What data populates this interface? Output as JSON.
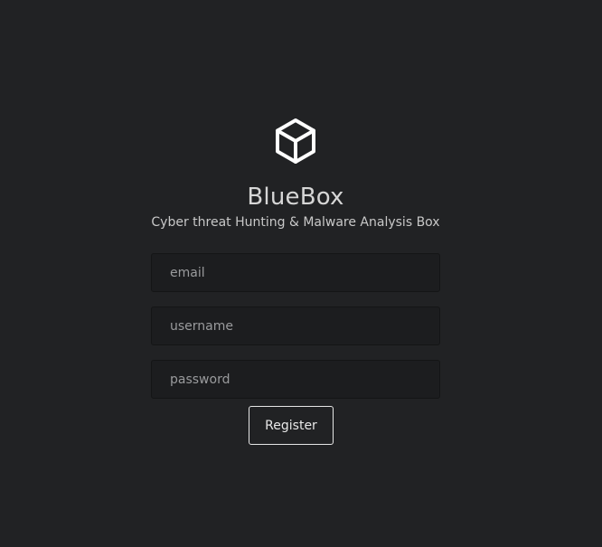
{
  "brand": {
    "icon": "cube-icon",
    "title": "BlueBox",
    "subtitle": "Cyber threat Hunting & Malware Analysis Box"
  },
  "form": {
    "email_placeholder": "email",
    "username_placeholder": "username",
    "password_placeholder": "password",
    "register_label": "Register"
  },
  "colors": {
    "background": "#212224",
    "input_background": "#1c1d1f",
    "text": "#d6d6d6",
    "button_border": "#e6e6e6"
  }
}
